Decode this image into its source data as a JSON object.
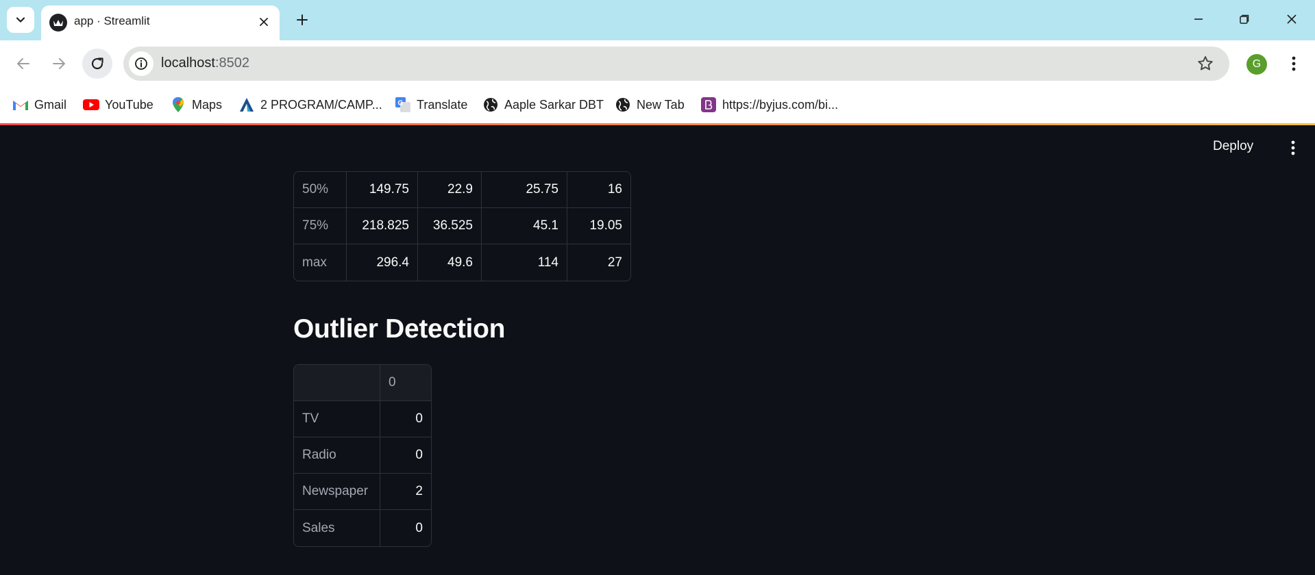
{
  "browser": {
    "tab": {
      "title": "app · Streamlit"
    },
    "address_bar": {
      "host": "localhost",
      "port": ":8502"
    },
    "profile_initial": "G",
    "bookmarks": [
      {
        "label": "Gmail",
        "icon": "gmail-icon"
      },
      {
        "label": "YouTube",
        "icon": "youtube-icon"
      },
      {
        "label": "Maps",
        "icon": "maps-icon"
      },
      {
        "label": "2 PROGRAM/CAMP...",
        "icon": "program-icon"
      },
      {
        "label": "Translate",
        "icon": "translate-icon"
      },
      {
        "label": "Aaple Sarkar DBT",
        "icon": "globe-icon"
      },
      {
        "label": "New Tab",
        "icon": "globe-icon"
      },
      {
        "label": "https://byjus.com/bi...",
        "icon": "byjus-icon"
      }
    ]
  },
  "app": {
    "deploy_label": "Deploy",
    "stats_table": {
      "rows": [
        {
          "index": "50%",
          "values": [
            "149.75",
            "22.9",
            "25.75",
            "16"
          ]
        },
        {
          "index": "75%",
          "values": [
            "218.825",
            "36.525",
            "45.1",
            "19.05"
          ]
        },
        {
          "index": "max",
          "values": [
            "296.4",
            "49.6",
            "114",
            "27"
          ]
        }
      ]
    },
    "outlier_heading": "Outlier Detection",
    "outlier_table": {
      "header": "0",
      "rows": [
        {
          "index": "TV",
          "value": "0"
        },
        {
          "index": "Radio",
          "value": "0"
        },
        {
          "index": "Newspaper",
          "value": "2"
        },
        {
          "index": "Sales",
          "value": "0"
        }
      ]
    }
  }
}
